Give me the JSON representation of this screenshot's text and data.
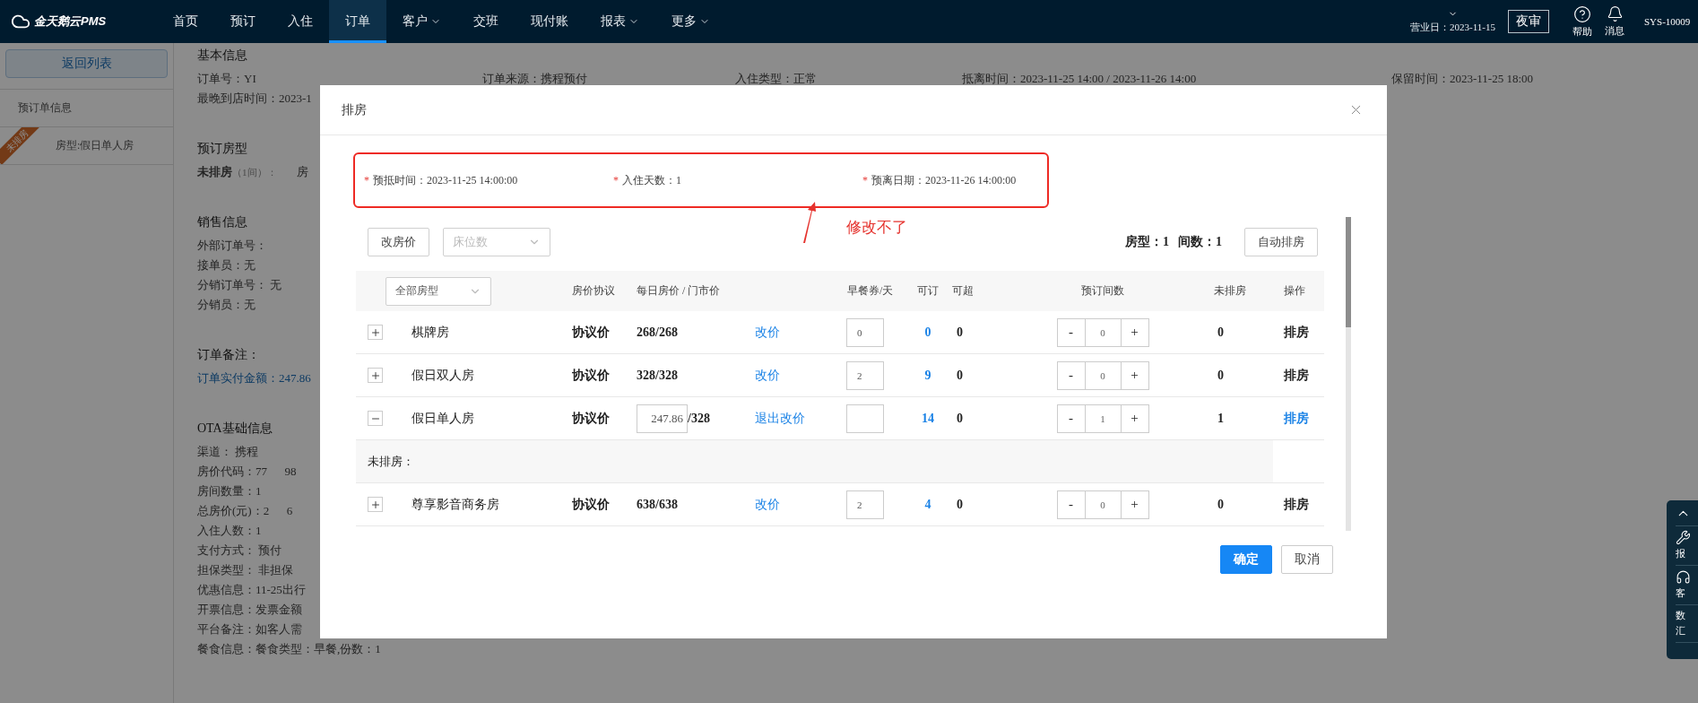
{
  "nav": {
    "logo": "金天鹅云PMS",
    "items": [
      {
        "label": "首页",
        "selected": false,
        "dropdown": false
      },
      {
        "label": "预订",
        "selected": false,
        "dropdown": false
      },
      {
        "label": "入住",
        "selected": false,
        "dropdown": false
      },
      {
        "label": "订单",
        "selected": true,
        "dropdown": false
      },
      {
        "label": "客户",
        "selected": false,
        "dropdown": true
      },
      {
        "label": "交班",
        "selected": false,
        "dropdown": false
      },
      {
        "label": "现付账",
        "selected": false,
        "dropdown": false
      },
      {
        "label": "报表",
        "selected": false,
        "dropdown": true
      },
      {
        "label": "更多",
        "selected": false,
        "dropdown": true
      }
    ],
    "business_date": "营业日：2023-11-15",
    "night_audit": "夜审",
    "help": "帮助",
    "messages": "消息",
    "user": "SYS-10009"
  },
  "sidebar": {
    "back_button": "返回列表",
    "items": [
      {
        "kind": "plain",
        "label": "预订单信息"
      },
      {
        "kind": "room",
        "ribbon": "未排房",
        "label": "房型:假日单人房"
      }
    ]
  },
  "order": {
    "top_row": [
      "订单来源：携程预付",
      "入住类型：正常",
      "抵离时间：2023-11-25 14:00 / 2023-11-26 14:00",
      "保留时间：2023-11-25 18:00"
    ],
    "sections": [
      {
        "title": "基本信息",
        "lines": [
          {
            "kind": "top_row",
            "text": "订单号：YI"
          },
          {
            "kind": "plain",
            "text": "最晚到店时间：2023-1"
          }
        ]
      },
      {
        "title": "预订房型",
        "lines": [
          {
            "kind": "pending",
            "label": "未排房",
            "note": "（1间）：",
            "text": "房"
          }
        ]
      },
      {
        "title": "销售信息",
        "lines": [
          {
            "kind": "plain",
            "text": "外部订单号："
          },
          {
            "kind": "plain",
            "text": "接单员：无"
          },
          {
            "kind": "plain",
            "text": "分销订单号： 无"
          },
          {
            "kind": "plain",
            "text": "分销员：无"
          }
        ]
      },
      {
        "title": "订单备注：",
        "lines": [
          {
            "kind": "link",
            "text": "订单实付金额：247.86"
          }
        ]
      },
      {
        "title": "OTA基础信息",
        "lines": [
          {
            "kind": "plain",
            "text": "渠道： 携程"
          },
          {
            "kind": "plain",
            "text": "房价代码：77      98"
          },
          {
            "kind": "plain",
            "text": "房间数量：1"
          },
          {
            "kind": "plain",
            "text": "总房价(元)：2      6"
          },
          {
            "kind": "plain",
            "text": "入住人数：1"
          },
          {
            "kind": "plain",
            "text": "支付方式： 预付"
          },
          {
            "kind": "plain",
            "text": "担保类型： 非担保"
          },
          {
            "kind": "plain",
            "text": "优惠信息：11-25出行"
          },
          {
            "kind": "plain",
            "text": "开票信息：发票金额"
          },
          {
            "kind": "plain",
            "text": "平台备注：如客人需"
          },
          {
            "kind": "plain",
            "text": "餐食信息：餐食类型：早餐,份数：1"
          }
        ]
      }
    ]
  },
  "modal": {
    "title": "排房",
    "fields": [
      {
        "mark": "*",
        "label": "预抵时间：",
        "value": "2023-11-25 14:00:00"
      },
      {
        "mark": "*",
        "label": "入住天数：",
        "value": "1"
      },
      {
        "mark": "*",
        "label": "预离日期：",
        "value": "2023-11-26 14:00:00"
      }
    ],
    "annotation": "修改不了",
    "toolbar": {
      "change_price": "改房价",
      "bed_select": {
        "placeholder": "床位数"
      },
      "summary": [
        {
          "label": "房型：",
          "value": "1"
        },
        {
          "label": "间数：",
          "value": "1"
        }
      ],
      "auto_assign": "自动排房"
    },
    "table": {
      "type_filter": "全部房型",
      "columns": [
        "房价协议",
        "每日房价 / 门市价",
        "早餐券/天",
        "可订",
        "可超",
        "预订间数",
        "未排房",
        "操作"
      ],
      "stepper": {
        "minus": "-",
        "plus": "+"
      },
      "rows": [
        {
          "kind": "room",
          "expanded": false,
          "name": "棋牌房",
          "agreement": "协议价",
          "editing": false,
          "price": "268/268",
          "link": "改价",
          "breakfast": "0",
          "available": "0",
          "over": "0",
          "count": "0",
          "unassigned": "0",
          "action": "排房",
          "highlighted": false
        },
        {
          "kind": "room",
          "expanded": false,
          "name": "假日双人房",
          "agreement": "协议价",
          "editing": false,
          "price": "328/328",
          "link": "改价",
          "breakfast": "2",
          "available": "9",
          "over": "0",
          "count": "0",
          "unassigned": "0",
          "action": "排房",
          "highlighted": false
        },
        {
          "kind": "room",
          "expanded": true,
          "name": "假日单人房",
          "agreement": "协议价",
          "editing": true,
          "price_input": "247.86",
          "price_suffix": "/328",
          "link": "退出改价",
          "available": "14",
          "over": "0",
          "count": "1",
          "unassigned": "1",
          "action": "排房",
          "highlighted": true
        },
        {
          "kind": "section",
          "label": "未排房："
        },
        {
          "kind": "room",
          "expanded": false,
          "name": "尊享影音商务房",
          "agreement": "协议价",
          "editing": false,
          "price": "638/638",
          "link": "改价",
          "breakfast": "2",
          "available": "4",
          "over": "0",
          "count": "0",
          "unassigned": "0",
          "action": "排房",
          "highlighted": false
        }
      ]
    },
    "buttons": {
      "confirm": "确定",
      "cancel": "取消"
    }
  },
  "side_panel": {
    "items": [
      {
        "kind": "up"
      },
      {
        "kind": "wrench",
        "label": "报"
      },
      {
        "kind": "headset",
        "label": "客"
      },
      {
        "kind": "text",
        "lines": [
          "数",
          "汇"
        ]
      }
    ]
  }
}
